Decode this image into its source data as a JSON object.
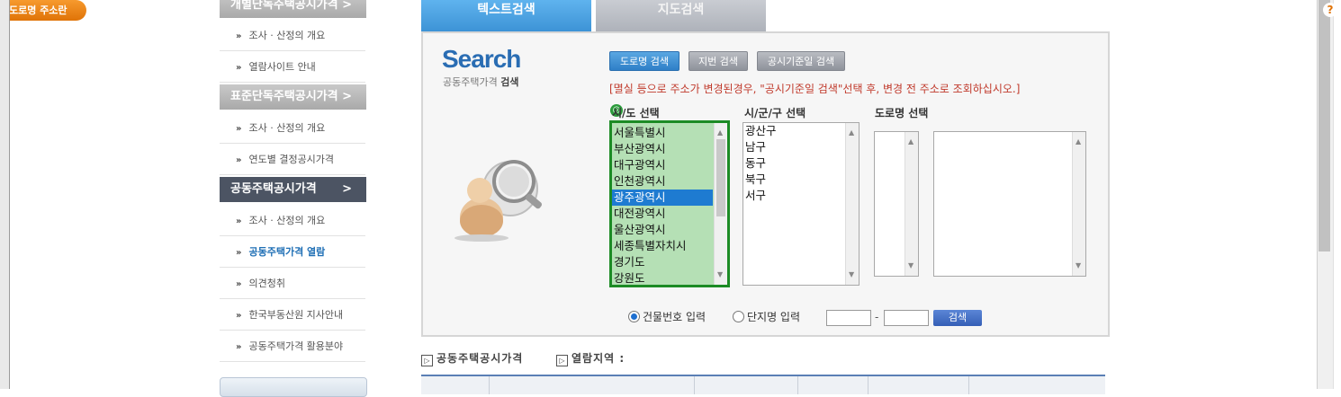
{
  "sidebar": {
    "sections": [
      {
        "title": "개별단독주택공시가격",
        "arrow": ">"
      },
      {
        "title": "표준단독주택공시가격",
        "arrow": ">"
      },
      {
        "title": "공동주택공시가격",
        "arrow": ">"
      }
    ],
    "items": [
      {
        "label": "조사 · 산정의 개요"
      },
      {
        "label": "열람사이트 안내"
      },
      {
        "label": "조사 · 산정의 개요"
      },
      {
        "label": "연도별 결정공시가격"
      },
      {
        "label": "조사 · 산정의 개요"
      },
      {
        "label": "공동주택가격 열람"
      },
      {
        "label": "의견청취"
      },
      {
        "label": "한국부동산원 지사안내"
      },
      {
        "label": "공동주택가격 활용분야"
      }
    ],
    "bullet": "»"
  },
  "tabs": [
    {
      "label": "텍스트검색",
      "active": true
    },
    {
      "label": "지도검색",
      "active": false
    }
  ],
  "logo": {
    "title": "Search",
    "sub_prefix": "공동주택가격",
    "sub_bold": "검색"
  },
  "search_buttons": {
    "road": "도로명 검색",
    "lot": "지번 검색",
    "date": "공시기준일 검색",
    "guide": "도로명 주소란",
    "guide_icon": "?"
  },
  "notice": "[멸실 등으로 주소가 변경된경우, \"공시기준일 검색\"선택 후, 변경 전 주소로 조회하십시오.]",
  "columns": {
    "sido": "시/도 선택",
    "sigungu": "시/군/구 선택",
    "road": "도로명 선택"
  },
  "sido_options": [
    "서울특별시",
    "부산광역시",
    "대구광역시",
    "인천광역시",
    "광주광역시",
    "대전광역시",
    "울산광역시",
    "세종특별자치시",
    "경기도",
    "강원도"
  ],
  "sido_selected": "광주광역시",
  "sigungu_options": [
    "광산구",
    "남구",
    "동구",
    "북구",
    "서구"
  ],
  "radios": {
    "building": {
      "label": "건물번호 입력",
      "checked": true
    },
    "complex": {
      "label": "단지명 입력",
      "checked": false
    }
  },
  "search_label": "검색",
  "dash": "-",
  "info": {
    "price_label": "공동주택공시가격",
    "region_label": "열람지역 :",
    "icon": "▷"
  },
  "colors": {
    "accent": "#2f7fc7",
    "highlight_green": "#1c8b25",
    "sidebar_dark": "#4c5463",
    "orange": "#e07307"
  }
}
